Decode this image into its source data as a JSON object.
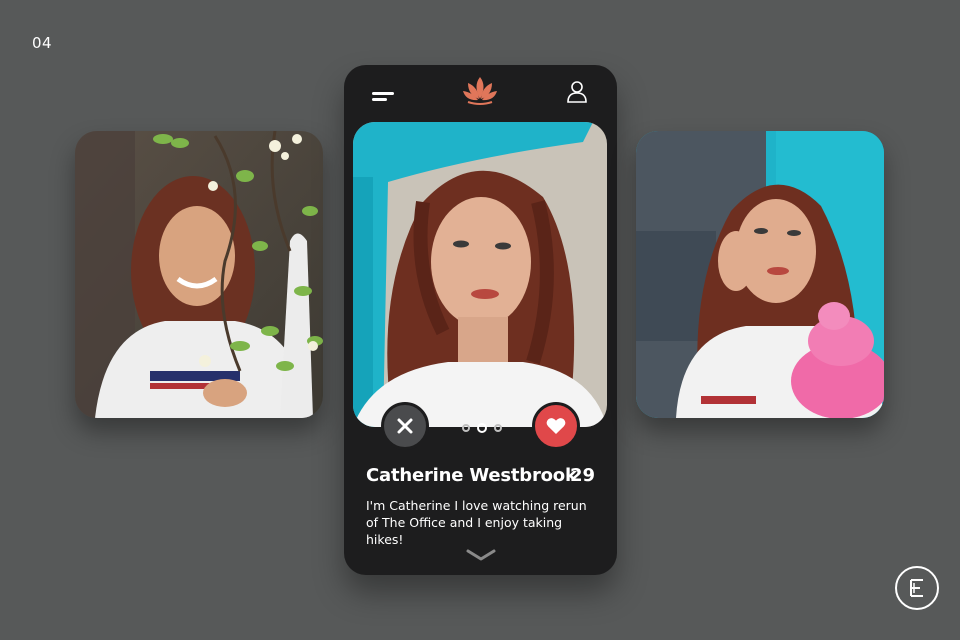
{
  "slide": {
    "number": "04"
  },
  "header": {
    "menu_icon": "hamburger-menu-icon",
    "logo_icon": "lotus-icon",
    "profile_icon": "user-icon"
  },
  "profile": {
    "name": "Catherine Westbrook",
    "age": "29",
    "bio": "I'm Catherine I love watching rerun of The Office and I enjoy taking hikes!"
  },
  "photo_pager": {
    "count": 3,
    "active_index": 1
  },
  "actions": {
    "dislike_icon": "close-icon",
    "like_icon": "heart-icon",
    "expand_icon": "chevron-down-icon"
  },
  "colors": {
    "background": "#575959",
    "phone": "#1d1d1e",
    "accent_logo": "#e0765a",
    "like": "#e0484a",
    "dislike": "#4a4b4d",
    "teal_wall": "#1fb3c9",
    "pink_object": "#f06aa8"
  },
  "brand_mark": {
    "icon": "brand-logo-e"
  }
}
